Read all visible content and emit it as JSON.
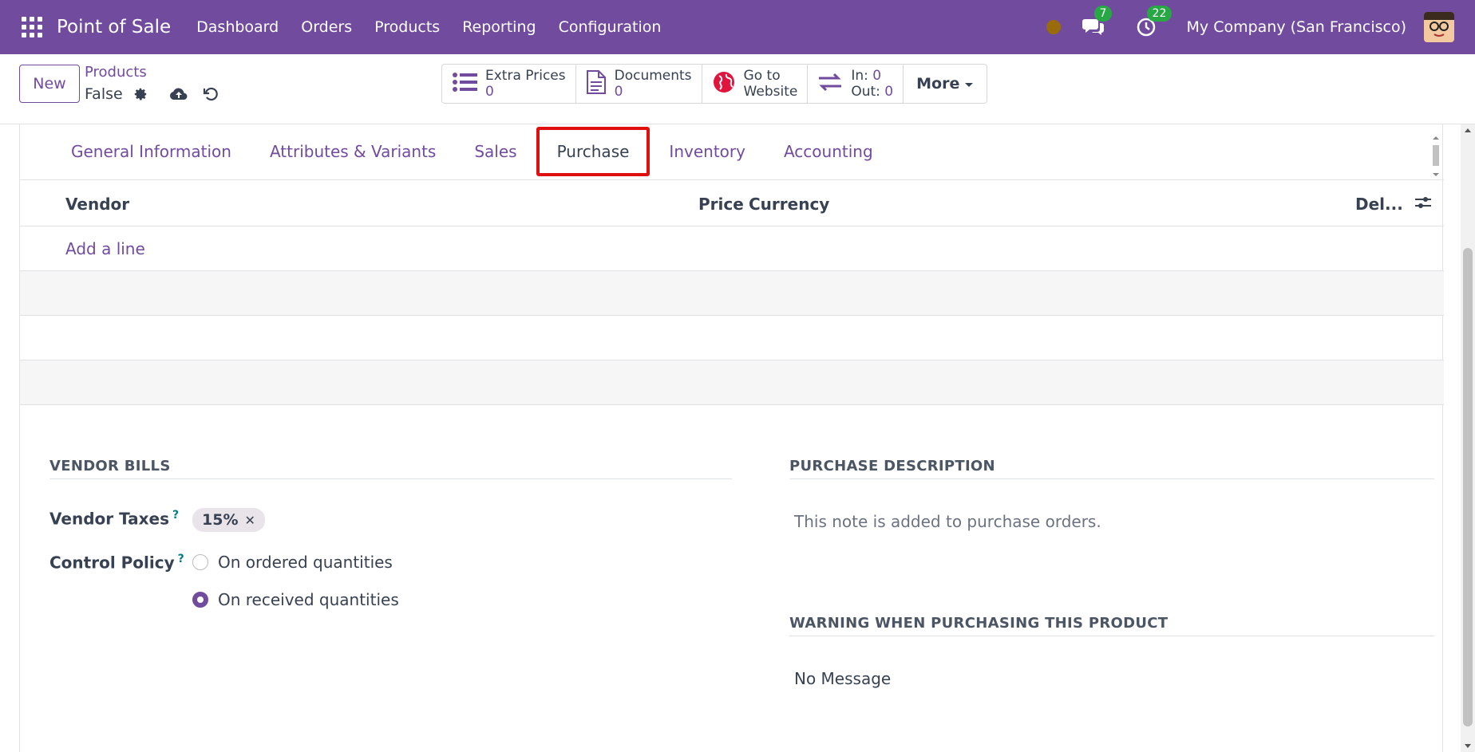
{
  "navbar": {
    "app_name": "Point of Sale",
    "menu": [
      "Dashboard",
      "Orders",
      "Products",
      "Reporting",
      "Configuration"
    ],
    "messages_count": "7",
    "activities_count": "22",
    "company": "My Company (San Francisco)",
    "color": "#714B9E"
  },
  "control": {
    "new_label": "New",
    "breadcrumb": "Products",
    "record_name": "False",
    "smart_buttons": {
      "extra_prices": {
        "label": "Extra Prices",
        "value": "0"
      },
      "documents": {
        "label": "Documents",
        "value": "0"
      },
      "website": {
        "label1": "Go to",
        "label2": "Website"
      },
      "stock": {
        "in_label": "In:",
        "in_value": "0",
        "out_label": "Out:",
        "out_value": "0"
      }
    },
    "more_label": "More"
  },
  "tabs": [
    "General Information",
    "Attributes & Variants",
    "Sales",
    "Purchase",
    "Inventory",
    "Accounting"
  ],
  "active_tab": "Purchase",
  "vendor_table": {
    "headers": {
      "vendor": "Vendor",
      "price": "Price",
      "currency": "Currency",
      "delivery": "Del..."
    },
    "add_line": "Add a line"
  },
  "vendor_bills": {
    "title": "VENDOR BILLS",
    "taxes_label": "Vendor Taxes",
    "taxes_help": "?",
    "tax_tag": "15%",
    "control_label": "Control Policy",
    "control_help": "?",
    "options": [
      "On ordered quantities",
      "On received quantities"
    ],
    "selected": "On received quantities"
  },
  "purchase_description": {
    "title": "PURCHASE DESCRIPTION",
    "placeholder": "This note is added to purchase orders."
  },
  "warning": {
    "title": "WARNING WHEN PURCHASING THIS PRODUCT",
    "value": "No Message"
  }
}
